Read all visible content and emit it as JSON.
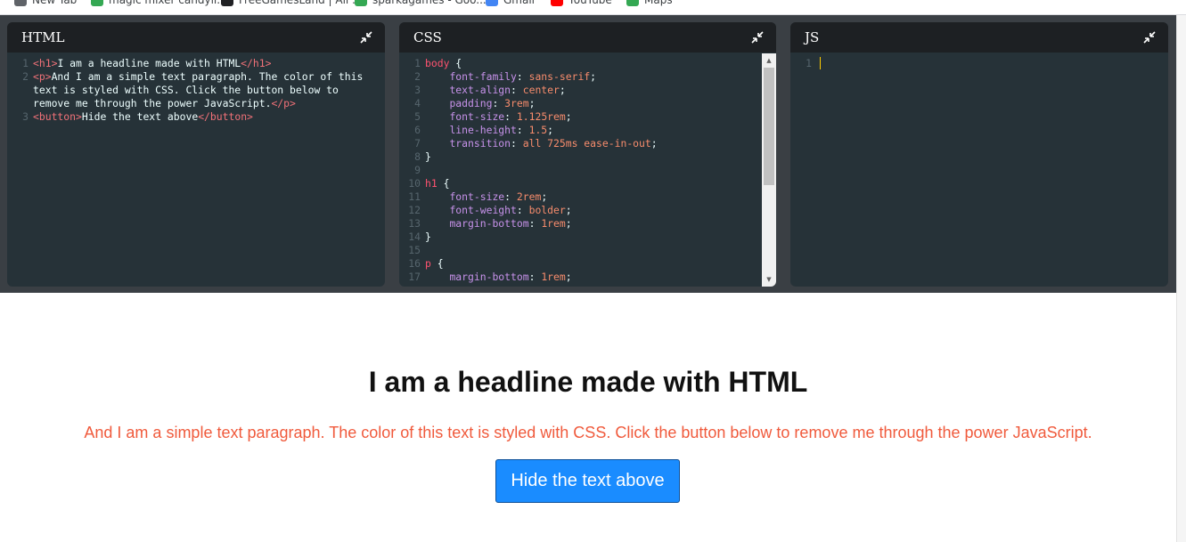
{
  "bookmarks": [
    {
      "label": "New Tab",
      "color": "#5f6368"
    },
    {
      "label": "magic mixer candyli...",
      "color": "#34a853"
    },
    {
      "label": "FreeGamesLand | All ...",
      "color": "#202124"
    },
    {
      "label": "sparkagames - Goo...",
      "color": "#34a853"
    },
    {
      "label": "Gmail",
      "color": "#4285f4"
    },
    {
      "label": "YouTube",
      "color": "#ff0000"
    },
    {
      "label": "Maps",
      "color": "#34a853"
    }
  ],
  "panels": {
    "html": {
      "title": "HTML"
    },
    "css": {
      "title": "CSS"
    },
    "js": {
      "title": "JS",
      "line_number": "1"
    }
  },
  "html_code": {
    "line1": {
      "num": "1",
      "open": "<h1>",
      "text": "I am a headline made with HTML",
      "close": "</h1>"
    },
    "line2": {
      "num": "2",
      "open": "<p>",
      "text_a": "And I am a simple text paragraph. The color of this",
      "text_b": "text is styled with CSS. Click the button below to",
      "text_c": "remove me through the power JavaScript.",
      "close": "</p>"
    },
    "line3": {
      "num": "3",
      "open": "<button>",
      "text": "Hide the text above",
      "close": "</button>"
    }
  },
  "css_code": [
    {
      "num": "1",
      "sel": "body",
      "brace": " {"
    },
    {
      "num": "2",
      "prop": "font-family",
      "val": "sans-serif"
    },
    {
      "num": "3",
      "prop": "text-align",
      "val": "center"
    },
    {
      "num": "4",
      "prop": "padding",
      "val": "3rem"
    },
    {
      "num": "5",
      "prop": "font-size",
      "val": "1.125rem"
    },
    {
      "num": "6",
      "prop": "line-height",
      "val": "1.5"
    },
    {
      "num": "7",
      "prop": "transition",
      "val": "all 725ms ease-in-out"
    },
    {
      "num": "8",
      "close": "}"
    },
    {
      "num": "9"
    },
    {
      "num": "10",
      "sel": "h1",
      "brace": " {"
    },
    {
      "num": "11",
      "prop": "font-size",
      "val": "2rem"
    },
    {
      "num": "12",
      "prop": "font-weight",
      "val": "bolder"
    },
    {
      "num": "13",
      "prop": "margin-bottom",
      "val": "1rem"
    },
    {
      "num": "14",
      "close": "}"
    },
    {
      "num": "15"
    },
    {
      "num": "16",
      "sel": "p",
      "brace": " {"
    },
    {
      "num": "17",
      "prop": "margin-bottom",
      "val": "1rem"
    }
  ],
  "preview": {
    "heading": "I am a headline made with HTML",
    "paragraph": "And I am a simple text paragraph. The color of this text is styled with CSS. Click the button below to remove me through the power JavaScript.",
    "button": "Hide the text above"
  },
  "colors": {
    "accent_button": "#1a8cff",
    "paragraph": "#f05a3c",
    "editor_bg": "#263238"
  }
}
